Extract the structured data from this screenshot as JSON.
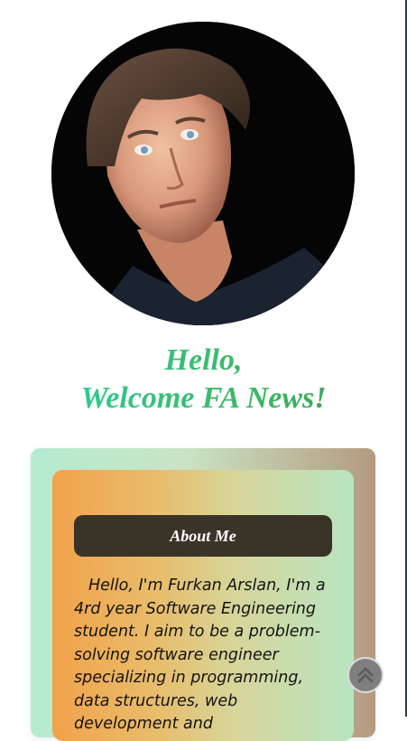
{
  "greeting": {
    "line1": "Hello,",
    "line2": "Welcome FA News!"
  },
  "about": {
    "title": "About Me",
    "text": "Hello, I'm Furkan Arslan, I'm a 4rd year Software Engineering student. I aim to be a problem-solving software engineer specializing in programming, data structures, web development and"
  },
  "icons": {
    "scroll_top": "double-chevron-up-icon"
  },
  "colors": {
    "greeting_green": "#2aa86a",
    "about_title_bg": "#3a3328",
    "scroll_button": "#7f7f7f"
  }
}
